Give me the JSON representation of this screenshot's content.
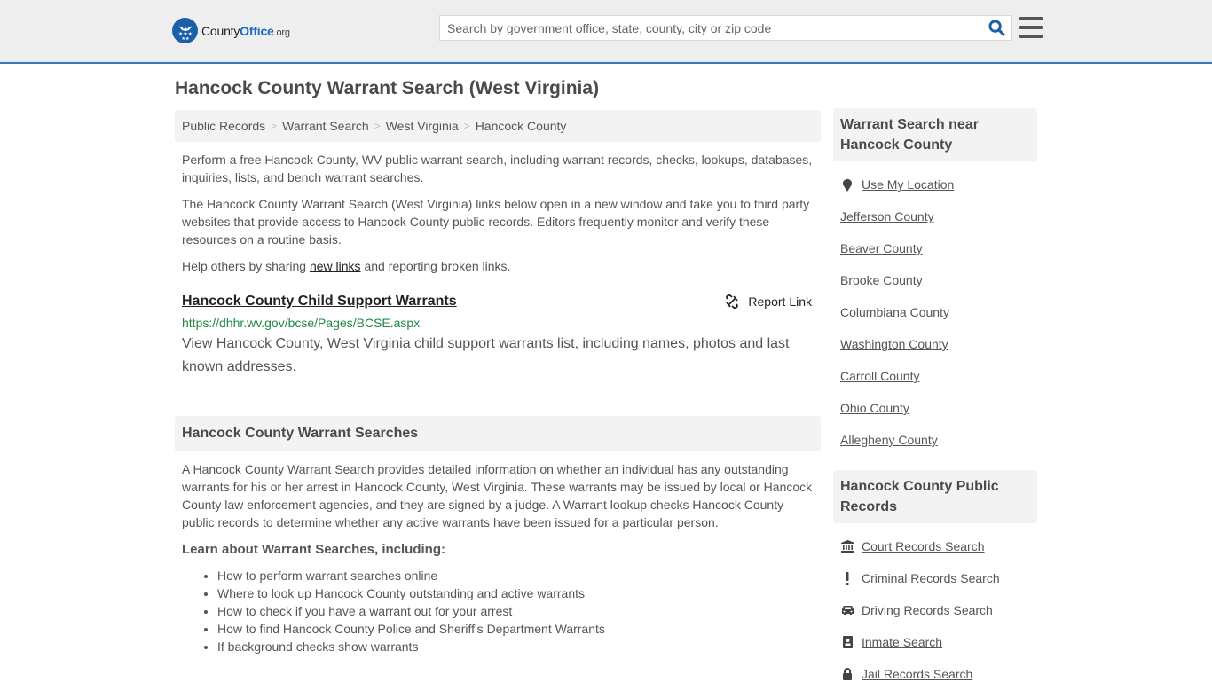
{
  "header": {
    "logo": {
      "brand_part1": "County",
      "brand_part2": "Office",
      "brand_suffix": ".org"
    },
    "search": {
      "placeholder": "Search by government office, state, county, city or zip code",
      "value": ""
    },
    "accent_color": "#337ab7"
  },
  "page": {
    "title": "Hancock County Warrant Search (West Virginia)"
  },
  "breadcrumb": [
    "Public Records",
    "Warrant Search",
    "West Virginia",
    "Hancock County"
  ],
  "intro": {
    "p1": "Perform a free Hancock County, WV public warrant search, including warrant records, checks, lookups, databases, inquiries, lists, and bench warrant searches.",
    "p2": "The Hancock County Warrant Search (West Virginia) links below open in a new window and take you to third party websites that provide access to Hancock County public records. Editors frequently monitor and verify these resources on a routine basis.",
    "p3_before": "Help others by sharing ",
    "p3_link": "new links",
    "p3_after": " and reporting broken links."
  },
  "results": [
    {
      "title": "Hancock County Child Support Warrants",
      "url": "https://dhhr.wv.gov/bcse/Pages/BCSE.aspx",
      "description": "View Hancock County, West Virginia child support warrants list, including names, photos and last known addresses.",
      "report_label": "Report Link"
    }
  ],
  "section": {
    "heading": "Hancock County Warrant Searches",
    "body": "A Hancock County Warrant Search provides detailed information on whether an individual has any outstanding warrants for his or her arrest in Hancock County, West Virginia. These warrants may be issued by local or Hancock County law enforcement agencies, and they are signed by a judge. A Warrant lookup checks Hancock County public records to determine whether any active warrants have been issued for a particular person.",
    "learn_heading": "Learn about Warrant Searches, including:",
    "bullets": [
      "How to perform warrant searches online",
      "Where to look up Hancock County outstanding and active warrants",
      "How to check if you have a warrant out for your arrest",
      "How to find Hancock County Police and Sheriff's Department Warrants",
      "If background checks show warrants"
    ]
  },
  "sidebar": {
    "nearby": {
      "heading": "Warrant Search near Hancock County",
      "use_location": "Use My Location",
      "items": [
        "Jefferson County",
        "Beaver County",
        "Brooke County",
        "Columbiana County",
        "Washington County",
        "Carroll County",
        "Ohio County",
        "Allegheny County"
      ]
    },
    "public_records": {
      "heading": "Hancock County Public Records",
      "items": [
        {
          "label": "Court Records Search",
          "icon": "courthouse-icon"
        },
        {
          "label": "Criminal Records Search",
          "icon": "exclamation-icon"
        },
        {
          "label": "Driving Records Search",
          "icon": "car-icon"
        },
        {
          "label": "Inmate Search",
          "icon": "id-badge-icon"
        },
        {
          "label": "Jail Records Search",
          "icon": "lock-icon"
        }
      ]
    }
  }
}
